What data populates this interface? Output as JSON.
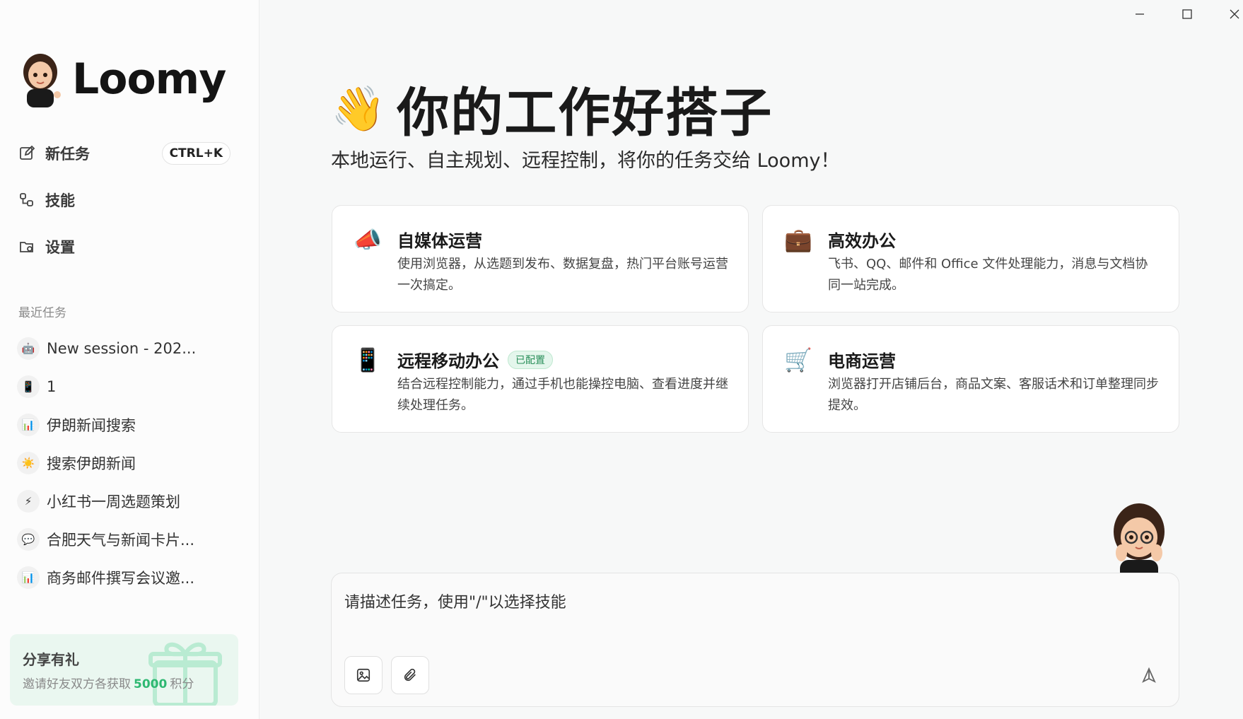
{
  "sidebar": {
    "brand_name": "Loomy",
    "nav": {
      "new_task": "新任务",
      "new_task_shortcut": "CTRL+K",
      "skills": "技能",
      "settings": "设置"
    },
    "recent_title": "最近任务",
    "recent": [
      {
        "label": "New session - 202...",
        "icon": "robot-icon"
      },
      {
        "label": "1",
        "icon": "phone-app-icon"
      },
      {
        "label": "伊朗新闻搜索",
        "icon": "bar-chart-icon"
      },
      {
        "label": "搜索伊朗新闻",
        "icon": "sun-icon"
      },
      {
        "label": "小红书一周选题策划",
        "icon": "lightning-icon"
      },
      {
        "label": "合肥天气与新闻卡片...",
        "icon": "chat-bubble-icon"
      },
      {
        "label": "商务邮件撰写会议邀...",
        "icon": "bar-chart-icon"
      }
    ],
    "share": {
      "title": "分享有礼",
      "desc_prefix": "邀请好友双方各获取",
      "points": "5000",
      "desc_suffix": "积分"
    }
  },
  "main": {
    "hero_title": "你的工作好搭子",
    "subtitle": "本地运行、自主规划、远程控制，将你的任务交给 Loomy！",
    "cards": [
      {
        "title": "自媒体运营",
        "desc": "使用浏览器，从选题到发布、数据复盘，热门平台账号运营一次搞定。",
        "icon": "megaphone-icon"
      },
      {
        "title": "高效办公",
        "desc": "飞书、QQ、邮件和 Office 文件处理能力，消息与文档协同一站完成。",
        "icon": "briefcase-icon"
      },
      {
        "title": "远程移动办公",
        "badge": "已配置",
        "desc": "结合远程控制能力，通过手机也能操控电脑、查看进度并继续处理任务。",
        "icon": "phone-app-icon"
      },
      {
        "title": "电商运营",
        "desc": "浏览器打开店铺后台，商品文案、客服话术和订单整理同步提效。",
        "icon": "shopping-cart-icon"
      }
    ],
    "composer": {
      "placeholder": "请描述任务，使用\"/\"以选择技能"
    }
  },
  "colors": {
    "accent_green": "#2eb872",
    "background": "#f7f8f8"
  }
}
